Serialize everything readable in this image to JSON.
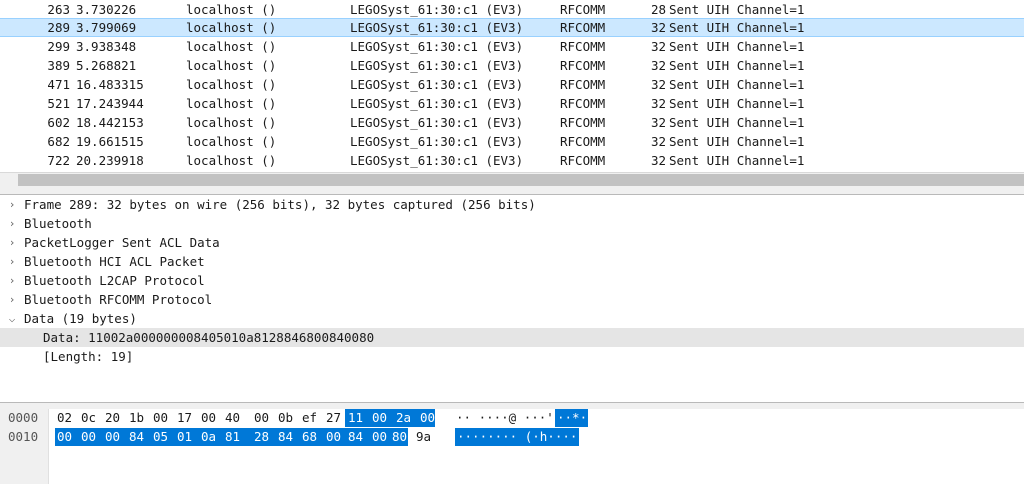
{
  "packets": [
    {
      "no": "263",
      "time": "3.730226",
      "source": "localhost ()",
      "destination": "LEGOSyst_61:30:c1 (EV3)",
      "protocol": "RFCOMM",
      "length": "28",
      "info": "Sent UIH Channel=1"
    },
    {
      "no": "289",
      "time": "3.799069",
      "source": "localhost ()",
      "destination": "LEGOSyst_61:30:c1 (EV3)",
      "protocol": "RFCOMM",
      "length": "32",
      "info": "Sent UIH Channel=1"
    },
    {
      "no": "299",
      "time": "3.938348",
      "source": "localhost ()",
      "destination": "LEGOSyst_61:30:c1 (EV3)",
      "protocol": "RFCOMM",
      "length": "32",
      "info": "Sent UIH Channel=1"
    },
    {
      "no": "389",
      "time": "5.268821",
      "source": "localhost ()",
      "destination": "LEGOSyst_61:30:c1 (EV3)",
      "protocol": "RFCOMM",
      "length": "32",
      "info": "Sent UIH Channel=1"
    },
    {
      "no": "471",
      "time": "16.483315",
      "source": "localhost ()",
      "destination": "LEGOSyst_61:30:c1 (EV3)",
      "protocol": "RFCOMM",
      "length": "32",
      "info": "Sent UIH Channel=1"
    },
    {
      "no": "521",
      "time": "17.243944",
      "source": "localhost ()",
      "destination": "LEGOSyst_61:30:c1 (EV3)",
      "protocol": "RFCOMM",
      "length": "32",
      "info": "Sent UIH Channel=1"
    },
    {
      "no": "602",
      "time": "18.442153",
      "source": "localhost ()",
      "destination": "LEGOSyst_61:30:c1 (EV3)",
      "protocol": "RFCOMM",
      "length": "32",
      "info": "Sent UIH Channel=1"
    },
    {
      "no": "682",
      "time": "19.661515",
      "source": "localhost ()",
      "destination": "LEGOSyst_61:30:c1 (EV3)",
      "protocol": "RFCOMM",
      "length": "32",
      "info": "Sent UIH Channel=1"
    },
    {
      "no": "722",
      "time": "20.239918",
      "source": "localhost ()",
      "destination": "LEGOSyst_61:30:c1 (EV3)",
      "protocol": "RFCOMM",
      "length": "32",
      "info": "Sent UIH Channel=1"
    }
  ],
  "selected_packet": "289",
  "details": [
    {
      "label": "Frame 289: 32 bytes on wire (256 bits), 32 bytes captured (256 bits)",
      "expanded": false,
      "icon": "chevron-right-icon"
    },
    {
      "label": "Bluetooth",
      "expanded": false,
      "icon": "chevron-right-icon"
    },
    {
      "label": "PacketLogger Sent ACL Data",
      "expanded": false,
      "icon": "chevron-right-icon"
    },
    {
      "label": "Bluetooth HCI ACL Packet",
      "expanded": false,
      "icon": "chevron-right-icon"
    },
    {
      "label": "Bluetooth L2CAP Protocol",
      "expanded": false,
      "icon": "chevron-right-icon"
    },
    {
      "label": "Bluetooth RFCOMM Protocol",
      "expanded": false,
      "icon": "chevron-right-icon"
    },
    {
      "label": "Data (19 bytes)",
      "expanded": true,
      "icon": "chevron-down-icon"
    }
  ],
  "data_children": [
    {
      "label": "Data: 11002a000000008405010a8128846800840080",
      "selected": true
    },
    {
      "label": "[Length: 19]",
      "selected": false
    }
  ],
  "bytes": {
    "rows": [
      {
        "offset": "0000",
        "hex": [
          "02",
          "0c",
          "20",
          "1b",
          "00",
          "17",
          "00",
          "40",
          "00",
          "0b",
          "ef",
          "27",
          "11",
          "00",
          "2a",
          "00"
        ],
        "ascii_plain": "·· ····@ ···'",
        "ascii_hl": "··*·"
      },
      {
        "offset": "0010",
        "hex": [
          "00",
          "00",
          "00",
          "84",
          "05",
          "01",
          "0a",
          "81",
          "28",
          "84",
          "68",
          "00",
          "84",
          "00",
          "80",
          "9a"
        ],
        "ascii_plain": "",
        "ascii_hl": "········ (·h····"
      }
    ]
  },
  "colors": {
    "selected_row": "#cce8ff",
    "byte_highlight": "#0078d7",
    "detail_selected": "#e5e5e5"
  }
}
